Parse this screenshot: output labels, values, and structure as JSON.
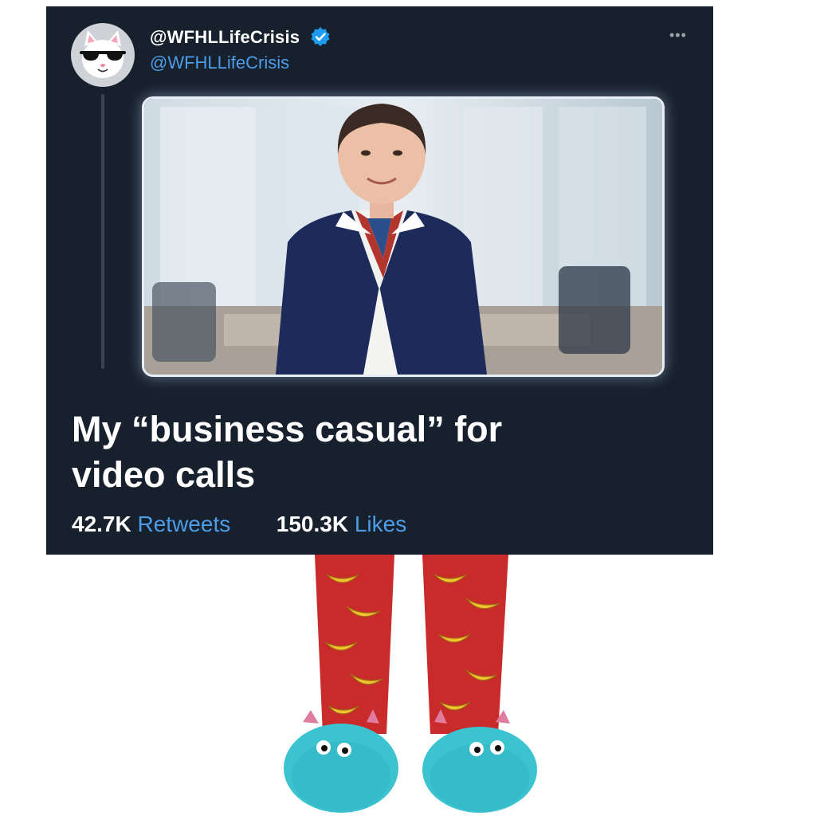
{
  "tweet": {
    "display_name": "@WFHLLifeCrisis",
    "handle": "@WFHLLifeCrisis",
    "more_label": "•••",
    "text_line1": "My “business casual” for",
    "text_line2": "video calls",
    "retweets_count": "42.7K",
    "retweets_label": "Retweets",
    "likes_count": "150.3K",
    "likes_label": "Likes",
    "verified_icon": "verified-check-icon",
    "avatar_icon": "cat-with-sunglasses-icon"
  },
  "colors": {
    "card_background": "#17202d",
    "accent_blue": "#4d9de8",
    "pants_red": "#c92a2a",
    "banana_yellow": "#f2c230",
    "slipper_teal": "#3cc3d0"
  }
}
